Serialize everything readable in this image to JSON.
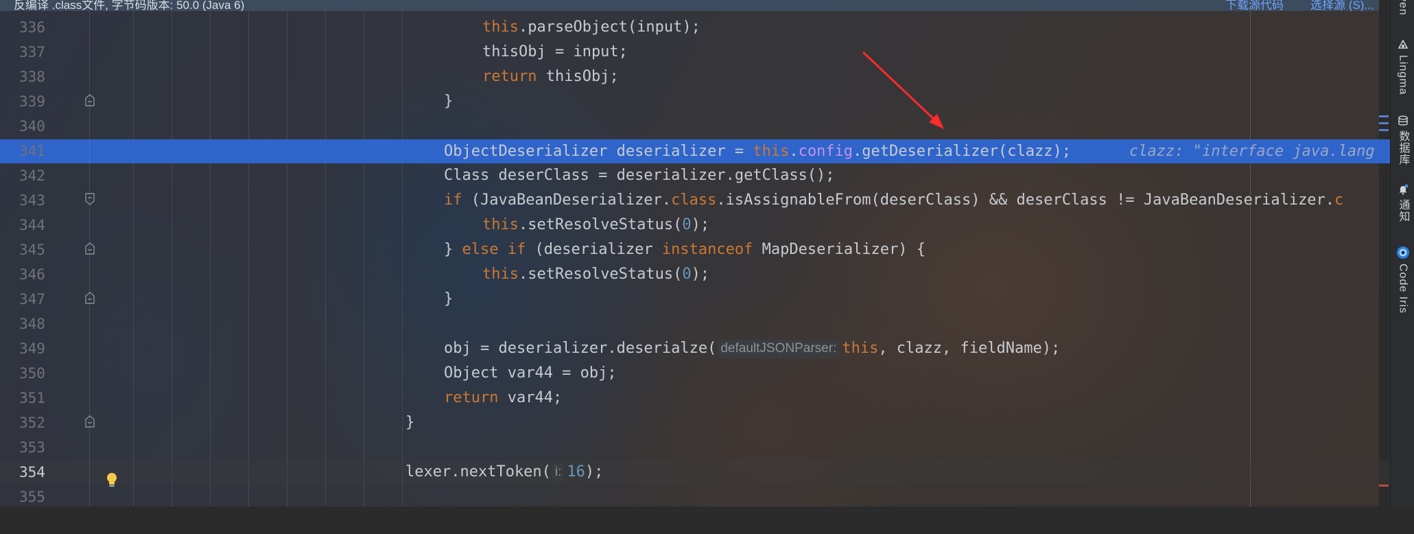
{
  "banner": {
    "message": "反编译 .class文件, 字节码版本: 50.0 (Java 6)",
    "download_link": "下载源代码",
    "choose_link": "选择源 (S)..."
  },
  "editor": {
    "line_numbers": [
      "336",
      "337",
      "338",
      "339",
      "340",
      "341",
      "342",
      "343",
      "344",
      "345",
      "346",
      "347",
      "348",
      "349",
      "350",
      "351",
      "352",
      "353",
      "354",
      "355"
    ],
    "current_line": "354",
    "selected_line": "341",
    "code": {
      "l336": {
        "this": "this",
        "rest": ".parseObject(input);"
      },
      "l337": {
        "text": "thisObj = input;"
      },
      "l338": {
        "kw": "return",
        "rest": " thisObj;"
      },
      "l339": {
        "text": "}"
      },
      "l341": {
        "a": "ObjectDeserializer deserializer = ",
        "this": "this",
        "dot": ".",
        "field": "config",
        "b": ".getDeserializer(clazz);",
        "inline_value": "clazz: \"interface java.lang"
      },
      "l342": {
        "text": "Class deserClass = deserializer.getClass();"
      },
      "l343": {
        "kw": "if",
        "a": " (JavaBeanDeserializer.",
        "cls": "class",
        "b": ".isAssignableFrom(deserClass) && deserClass != JavaBeanDeserializer.",
        "c": "c"
      },
      "l344": {
        "this": "this",
        "a": ".setResolveStatus(",
        "num": "0",
        "b": ");"
      },
      "l345": {
        "a": "} ",
        "kw1": "else",
        "sp": " ",
        "kw2": "if",
        "b": " (deserializer ",
        "kw3": "instanceof",
        "c": " MapDeserializer) {"
      },
      "l346": {
        "this": "this",
        "a": ".setResolveStatus(",
        "num": "0",
        "b": ");"
      },
      "l347": {
        "text": "}"
      },
      "l349": {
        "a": "obj = deserializer.deserialze(",
        "hint": "defaultJSONParser:",
        "this": "this",
        "b": ", clazz, fieldName);"
      },
      "l350": {
        "text": "Object var44 = obj;"
      },
      "l351": {
        "kw": "return",
        "rest": " var44;"
      },
      "l352": {
        "text": "}"
      },
      "l354": {
        "a": "lexer.nextToken(",
        "hint": "i:",
        "num": "16",
        "b": ");"
      }
    }
  },
  "tool_window": {
    "items": [
      {
        "icon": "maven-icon",
        "label": "ven"
      },
      {
        "icon": "lingma-icon",
        "label": "Lingma"
      },
      {
        "icon": "database-icon",
        "label": "数据库"
      },
      {
        "icon": "bell-icon",
        "label": "通知"
      },
      {
        "icon": "code-iris-icon",
        "label": "Code Iris"
      }
    ]
  },
  "colors": {
    "selection": "#2f65ca",
    "keyword": "#cc7832",
    "number": "#6897bb",
    "field": "#c792ea",
    "arrow": "#ff2a2a"
  }
}
